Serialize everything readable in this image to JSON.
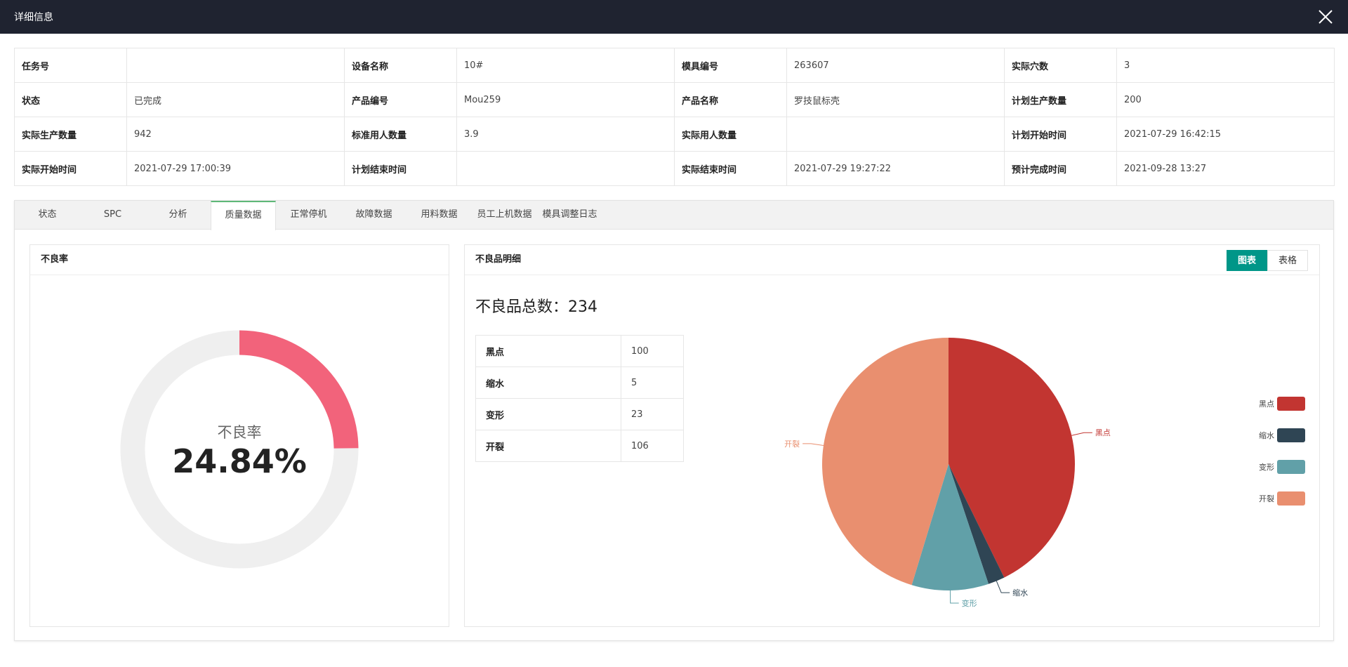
{
  "window": {
    "title": "详细信息"
  },
  "info": [
    [
      {
        "label": "任务号",
        "value": ""
      },
      {
        "label": "设备名称",
        "value": "10#"
      },
      {
        "label": "模具编号",
        "value": "263607"
      },
      {
        "label": "实际穴数",
        "value": "3"
      }
    ],
    [
      {
        "label": "状态",
        "value": "已完成"
      },
      {
        "label": "产品编号",
        "value": "Mou259"
      },
      {
        "label": "产品名称",
        "value": "罗技鼠标壳"
      },
      {
        "label": "计划生产数量",
        "value": "200"
      }
    ],
    [
      {
        "label": "实际生产数量",
        "value": "942"
      },
      {
        "label": "标准用人数量",
        "value": "3.9"
      },
      {
        "label": "实际用人数量",
        "value": ""
      },
      {
        "label": "计划开始时间",
        "value": "2021-07-29 16:42:15"
      }
    ],
    [
      {
        "label": "实际开始时间",
        "value": "2021-07-29 17:00:39"
      },
      {
        "label": "计划结束时间",
        "value": ""
      },
      {
        "label": "实际结束时间",
        "value": "2021-07-29 19:27:22"
      },
      {
        "label": "预计完成时间",
        "value": "2021-09-28 13:27"
      }
    ]
  ],
  "tabs": [
    "状态",
    "SPC",
    "分析",
    "质量数据",
    "正常停机",
    "故障数据",
    "用料数据",
    "员工上机数据",
    "模具调整日志"
  ],
  "active_tab": 3,
  "defect_rate": {
    "card_title": "不良率",
    "label": "不良率",
    "value_text": "24.84%",
    "value": 24.84
  },
  "defect_detail": {
    "card_title": "不良品明细",
    "toggle": {
      "chart": "图表",
      "table": "表格"
    },
    "total_text": "不良品总数：234",
    "rows": [
      {
        "name": "黑点",
        "count": "100"
      },
      {
        "name": "缩水",
        "count": "5"
      },
      {
        "name": "变形",
        "count": "23"
      },
      {
        "name": "开裂",
        "count": "106"
      }
    ]
  },
  "colors": {
    "rate": "#f2637b",
    "track": "#efefef",
    "accent": "#009688"
  },
  "chart_data": {
    "type": "pie",
    "categories": [
      "黑点",
      "缩水",
      "变形",
      "开裂"
    ],
    "values": [
      100,
      5,
      23,
      106
    ],
    "colors": [
      "#c23531",
      "#2f4554",
      "#61a0a8",
      "#e98f6f"
    ],
    "legend": "right"
  }
}
